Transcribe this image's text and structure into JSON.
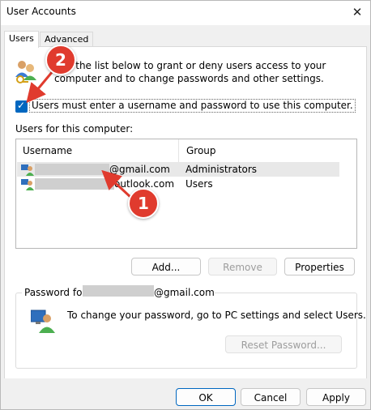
{
  "window": {
    "title": "User Accounts",
    "close_glyph": "✕"
  },
  "tabs": [
    {
      "label": "Users",
      "active": true
    },
    {
      "label": "Advanced",
      "active": false
    }
  ],
  "intro_text": "Use the list below to grant or deny users access to your computer and to change passwords and other settings.",
  "checkbox": {
    "label": "Users must enter a username and password to use this computer.",
    "checked": true
  },
  "users_section_label": "Users for this computer:",
  "columns": {
    "username": "Username",
    "group": "Group"
  },
  "users": [
    {
      "username_suffix": "@gmail.com",
      "group": "Administrators",
      "selected": true
    },
    {
      "username_suffix": "outlook.com",
      "group": "Users",
      "selected": false
    }
  ],
  "buttons": {
    "add": "Add...",
    "remove": "Remove",
    "properties": "Properties",
    "reset_password": "Reset Password...",
    "ok": "OK",
    "cancel": "Cancel",
    "apply": "Apply"
  },
  "password_section": {
    "label_prefix": "Password for",
    "label_suffix": "@gmail.com",
    "text": "To change your password, go to PC settings and select Users."
  },
  "annotations": {
    "one": "1",
    "two": "2"
  },
  "colors": {
    "accent": "#0067c0",
    "annotation": "#e03b2e"
  },
  "icons": {
    "users": "users-icon",
    "user": "user-icon",
    "pc": "pc-user-icon"
  }
}
